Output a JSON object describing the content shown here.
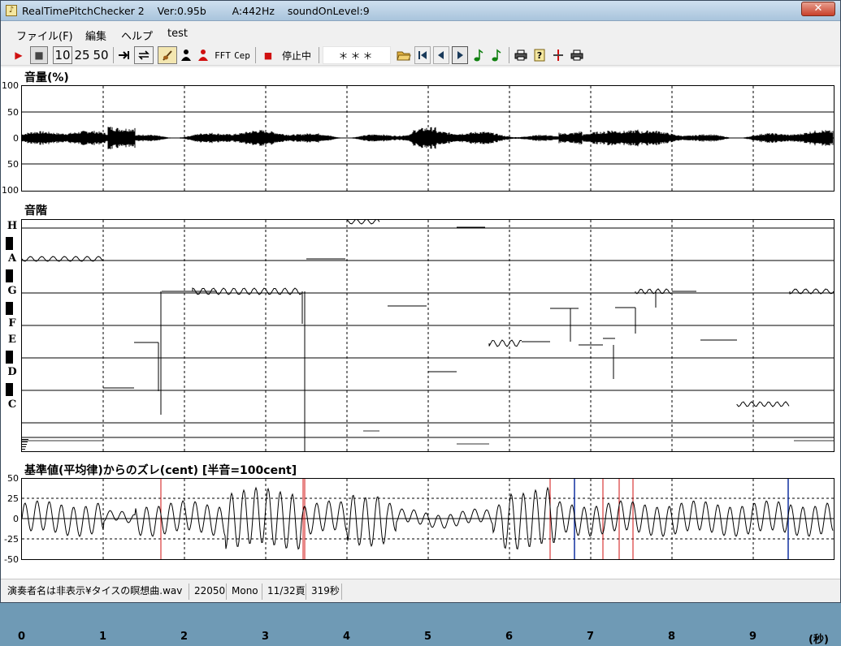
{
  "window": {
    "title": "RealTimePitchChecker 2    Ver:0.95b        A:442Hz    soundOnLevel:9",
    "close_glyph": "✕"
  },
  "menu": {
    "items": [
      "ファイル(F)",
      "編集",
      "ヘルプ",
      "test"
    ]
  },
  "toolbar": {
    "play_icon": "▶",
    "stop_icon": "■",
    "speed_10": "10",
    "speed_25": "25",
    "speed_50": "50",
    "fft_label": "FFT",
    "cep_label": "Cep",
    "record_icon": "■",
    "status_text": "停止中",
    "readout": "＊＊＊",
    "colors": {
      "red": "#d01010",
      "green": "#108010",
      "blue": "#1030a0"
    }
  },
  "volume": {
    "title": "音量(%)",
    "ticks": [
      "100",
      "50",
      "0",
      "50",
      "100"
    ]
  },
  "scale": {
    "title": "音階",
    "notes": [
      "H",
      "A",
      "G",
      "F",
      "E",
      "D",
      "C"
    ]
  },
  "deviation": {
    "title": "基準値(平均律)からのズレ(cent) [半音=100cent]",
    "ticks": [
      "50",
      "25",
      "0",
      "-25",
      "-50"
    ]
  },
  "time_axis": {
    "ticks": [
      "0",
      "1",
      "2",
      "3",
      "4",
      "5",
      "6",
      "7",
      "8",
      "9"
    ],
    "unit": "(秒)"
  },
  "status": {
    "file": "演奏者名は非表示¥タイスの瞑想曲.wav",
    "rate": "22050",
    "channels": "Mono",
    "page": "11/32頁",
    "duration": "319秒"
  }
}
